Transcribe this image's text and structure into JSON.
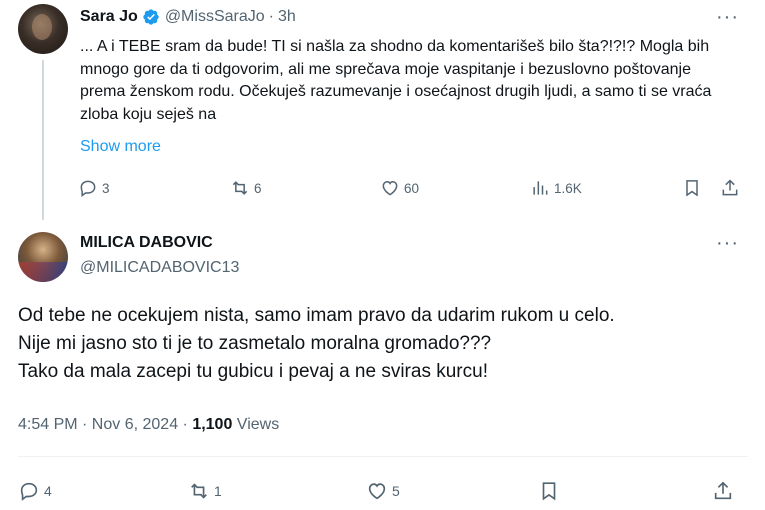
{
  "tweet1": {
    "display_name": "Sara Jo",
    "handle": "@MissSaraJo",
    "separator": "·",
    "time": "3h",
    "text": "... A i TEBE sram da bude! TI si našla za shodno da komentarišeš bilo šta?!?!? Mogla bih mnogo gore da ti odgovorim, ali me sprečava moje vaspitanje i bezuslovno poštovanje prema ženskom rodu. Očekuješ razumevanje i osećajnost drugih ljudi, a samo ti se vraća zloba koju seješ na",
    "show_more": "Show more",
    "replies": "3",
    "reposts": "6",
    "likes": "60",
    "views": "1.6K",
    "more": "···"
  },
  "tweet2": {
    "display_name": "MILICA DABOVIC",
    "handle": "@MILICADABOVIC13",
    "line1": "Od tebe ne ocekujem nista, samo imam pravo da udarim rukom u celo.",
    "line2": "Nije mi jasno sto ti je to zasmetalo moralna gromado???",
    "line3": "Tako da mala zacepi tu gubicu i pevaj a ne sviras kurcu!",
    "timestamp": "4:54 PM · Nov 6, 2024 · ",
    "views_count": "1,100",
    "views_label": " Views",
    "replies": "4",
    "reposts": "1",
    "likes": "5",
    "more": "···"
  },
  "colors": {
    "accent": "#1d9bf0",
    "secondary_text": "#536471",
    "primary_text": "#0f1419",
    "divider": "#eff3f4"
  },
  "icons": [
    "verified-badge-icon",
    "reply-icon",
    "repost-icon",
    "like-icon",
    "views-icon",
    "bookmark-icon",
    "share-icon",
    "more-icon"
  ]
}
